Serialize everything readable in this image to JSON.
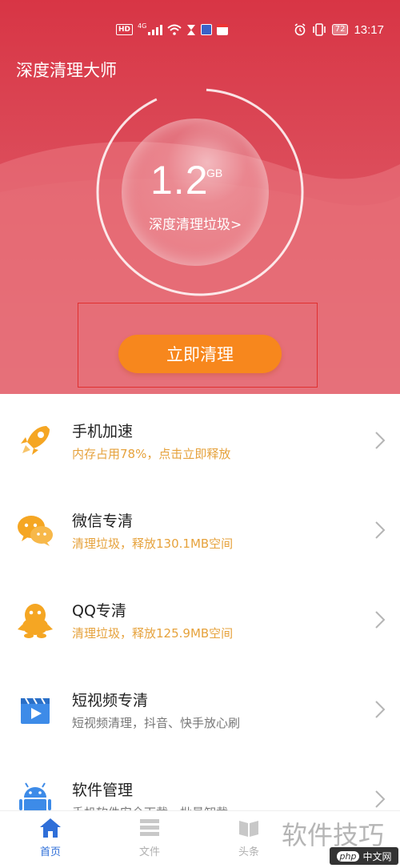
{
  "status_bar": {
    "hd_badge": "HD",
    "network": "4G",
    "battery": "72",
    "time": "13:17"
  },
  "app_title": "深度清理大师",
  "hero": {
    "junk_size_value": "1.2",
    "junk_size_unit": "GB",
    "deep_clean_link": "深度清理垃圾>",
    "clean_button": "立即清理"
  },
  "list": [
    {
      "title": "手机加速",
      "subtitle": "内存占用78%，点击立即释放",
      "subtitle_color": "#e6a23c",
      "icon": "rocket-icon"
    },
    {
      "title": "微信专清",
      "subtitle": "清理垃圾，释放130.1MB空间",
      "subtitle_color": "#e6a23c",
      "icon": "wechat-icon"
    },
    {
      "title": "QQ专清",
      "subtitle": "清理垃圾，释放125.9MB空间",
      "subtitle_color": "#e6a23c",
      "icon": "qq-penguin-icon"
    },
    {
      "title": "短视频专清",
      "subtitle": "短视频清理，抖音、快手放心刷",
      "subtitle_color": "#777777",
      "icon": "video-clapper-icon"
    },
    {
      "title": "软件管理",
      "subtitle": "手机软件安全下载，批量卸载",
      "subtitle_color": "#777777",
      "icon": "android-icon"
    }
  ],
  "bottom_nav": [
    {
      "label": "首页",
      "icon": "home-icon",
      "active": true
    },
    {
      "label": "文件",
      "icon": "file-list-icon",
      "active": false
    },
    {
      "label": "头条",
      "icon": "news-book-icon",
      "active": false
    }
  ],
  "watermark": {
    "text": "软件技巧",
    "logo_badge": "php",
    "logo_text": "中文网"
  },
  "colors": {
    "hero_red": "#d83545",
    "button_orange": "#f7871d",
    "icon_orange": "#f5a623",
    "icon_blue": "#3d8be8",
    "nav_active": "#2f6fd8",
    "nav_inactive": "#c8c8c8"
  }
}
